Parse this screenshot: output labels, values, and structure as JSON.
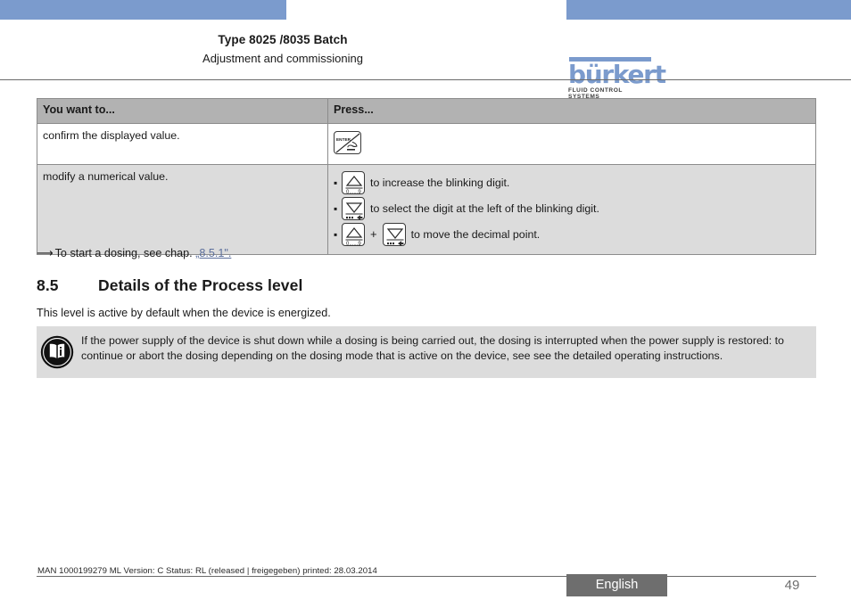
{
  "header": {
    "doc_type": "Type 8025 /8035 Batch",
    "doc_subtitle": "Adjustment and commissioning",
    "logo_word": "bürkert",
    "logo_tagline": "FLUID CONTROL SYSTEMS",
    "accent_blue": "#7b9bcd"
  },
  "table": {
    "columns": [
      "You want to...",
      "Press..."
    ],
    "rows": [
      {
        "action": "confirm the displayed value.",
        "keys_label": "ENTER",
        "bullets": []
      },
      {
        "action": "modify a numerical value.",
        "bullets": [
          {
            "key_label_a": "0......9",
            "text": "to increase the blinking digit."
          },
          {
            "key_label_b": "",
            "text": "to select the digit at the left of the blinking digit."
          },
          {
            "key_label_a": "0......9",
            "plus": "+",
            "key_label_b": "",
            "text": "to move the decimal point."
          }
        ]
      }
    ]
  },
  "cross_ref": {
    "arrow": "⟶",
    "lead_text": "To start a dosing, see chap.",
    "link_text": "„8.5.1\"."
  },
  "section": {
    "number": "8.5",
    "title": "Details of the Process level",
    "paragraph": "This level is active by default when the device is energized."
  },
  "note": {
    "text": "If the power supply of the device is shut down while a dosing is being carried out, the dosing is interrupted when the power supply is restored: to continue or abort the dosing depending on the dosing mode that is active on the device, see see the detailed operating instructions.",
    "background": "#dcdcdc"
  },
  "footer": {
    "meta": "MAN  1000199279  ML  Version: C Status: RL (released | freigegeben)  printed: 28.03.2014",
    "language": "English",
    "page_number": "49",
    "badge_color": "#6e6e6e"
  }
}
